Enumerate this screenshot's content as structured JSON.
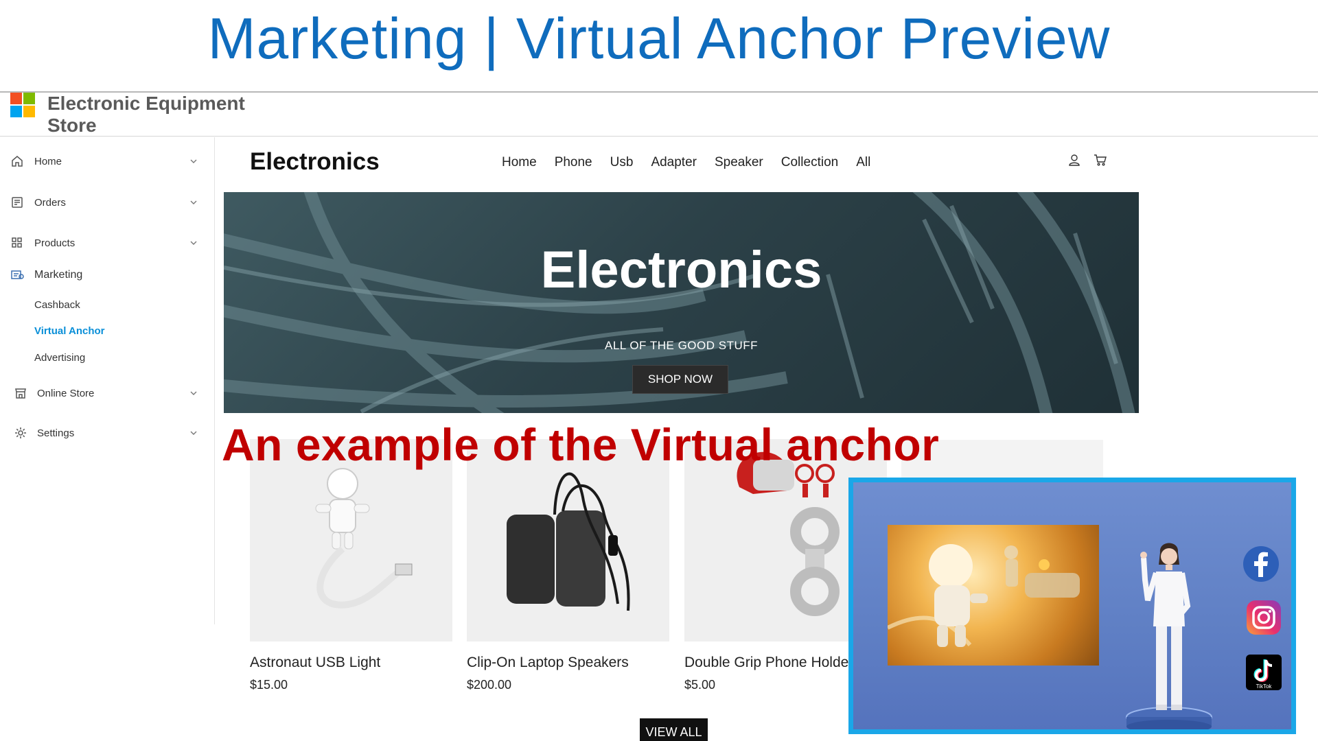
{
  "slide": {
    "title": "Marketing | Virtual Anchor Preview"
  },
  "app": {
    "store_name": "Electronic Equipment Store"
  },
  "sidebar": {
    "items": [
      {
        "label": "Home",
        "icon": "home-icon",
        "expandable": true
      },
      {
        "label": "Orders",
        "icon": "orders-icon",
        "expandable": true
      },
      {
        "label": "Products",
        "icon": "products-icon",
        "expandable": true
      },
      {
        "label": "Marketing",
        "icon": "marketing-icon",
        "expandable": false
      },
      {
        "label": "Online Store",
        "icon": "store-icon",
        "expandable": true
      },
      {
        "label": "Settings",
        "icon": "gear-icon",
        "expandable": true
      }
    ],
    "marketing_sub": [
      "Cashback",
      "Virtual Anchor",
      "Advertising"
    ],
    "active_sub": "Virtual Anchor"
  },
  "store": {
    "brand": "Electronics",
    "nav": [
      "Home",
      "Phone",
      "Usb",
      "Adapter",
      "Speaker",
      "Collection",
      "All"
    ],
    "hero": {
      "title": "Electronics",
      "subtitle": "ALL OF THE GOOD STUFF",
      "cta": "SHOP NOW"
    },
    "products": [
      {
        "name": "Astronaut USB Light",
        "price": "$15.00"
      },
      {
        "name": "Clip-On Laptop Speakers",
        "price": "$200.00"
      },
      {
        "name": "Double Grip Phone Holder",
        "price": "$5.00"
      }
    ],
    "view_all": "VIEW ALL"
  },
  "annotation": "An example of the Virtual anchor",
  "anchor_preview": {
    "socials": [
      "facebook-icon",
      "instagram-icon",
      "tiktok-icon"
    ],
    "tiktok_label": "TikTok"
  },
  "colors": {
    "title_blue": "#0f6cbd",
    "active_link": "#0a8fd8",
    "annotation_red": "#c00000",
    "frame_blue": "#1aa7e8"
  }
}
